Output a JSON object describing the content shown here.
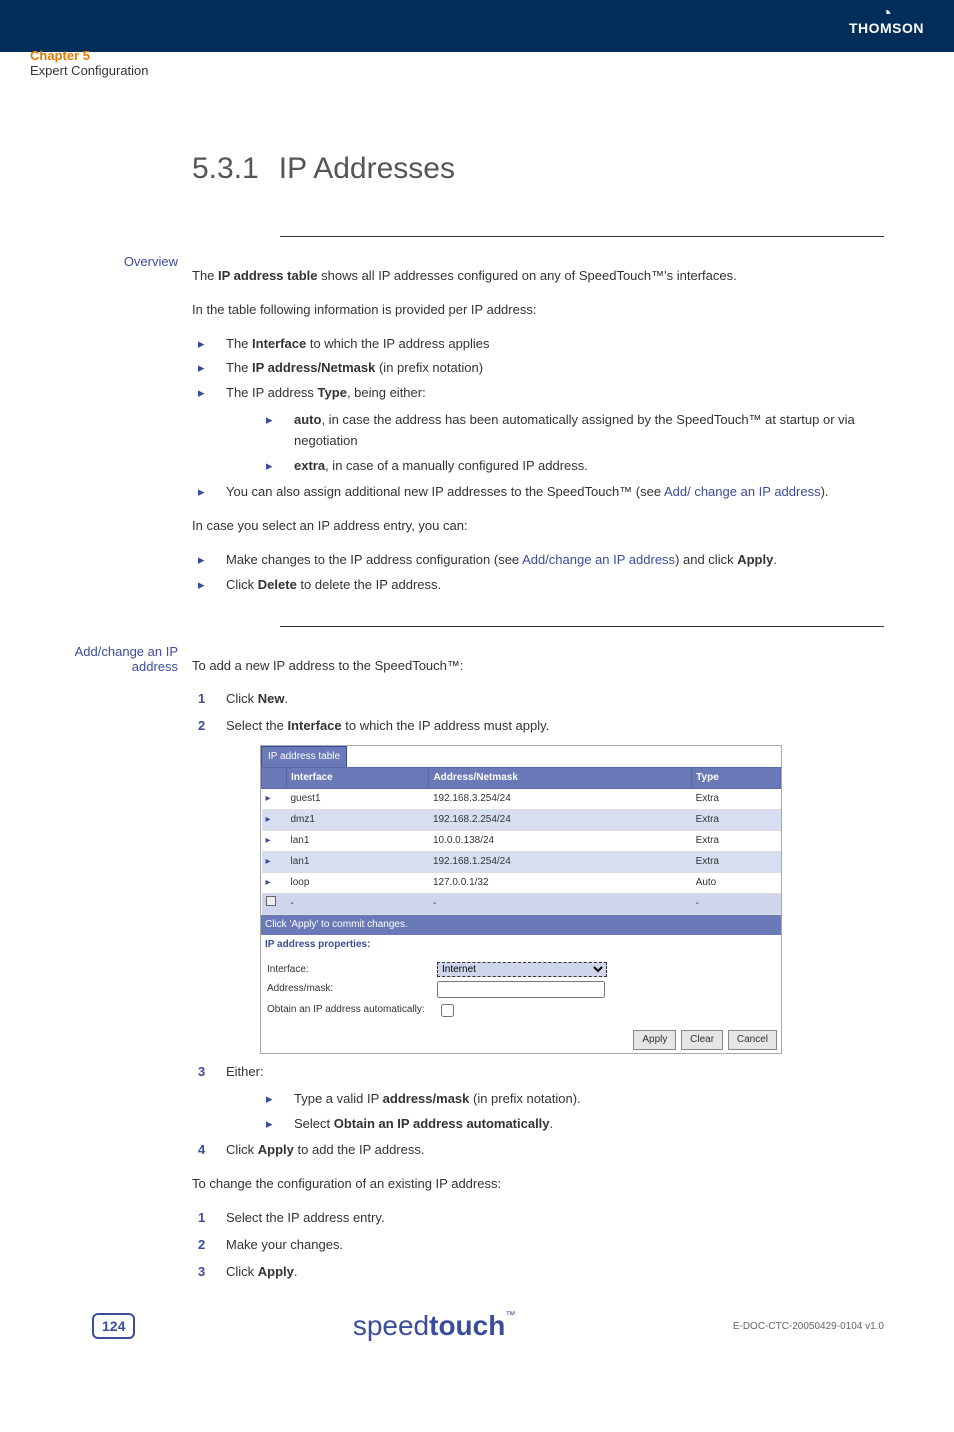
{
  "header": {
    "chapter": "Chapter 5",
    "subtitle": "Expert Configuration",
    "logo": "THOMSON"
  },
  "section": {
    "number": "5.3.1",
    "title": "IP Addresses"
  },
  "overview": {
    "label": "Overview",
    "p1_a": "The ",
    "p1_b": "IP address table",
    "p1_c": " shows all IP addresses configured on any of SpeedTouch™'s interfaces.",
    "p2": "In the table following information is provided per IP address:",
    "l1_a": "The ",
    "l1_b": "Interface",
    "l1_c": " to which the IP address applies",
    "l2_a": "The ",
    "l2_b": "IP address/Netmask",
    "l2_c": " (in prefix notation)",
    "l3_a": "The IP address ",
    "l3_b": "Type",
    "l3_c": ", being either:",
    "s1_a": "auto",
    "s1_b": ", in case the address has been automatically assigned by the SpeedTouch™ at startup or via negotiation",
    "s2_a": "extra",
    "s2_b": ", in case of a manually configured IP address.",
    "l4_a": "You can also assign additional new IP addresses to the SpeedTouch™ (see ",
    "l4_link": "Add/ change an IP address",
    "l4_c": ").",
    "p3": "In case you select an IP address entry, you can:",
    "l5_a": "Make changes to the IP address configuration (see ",
    "l5_link": "Add/change an IP address",
    "l5_b": ") and click ",
    "l5_c": "Apply",
    "l5_d": ".",
    "l6_a": "Click ",
    "l6_b": "Delete",
    "l6_c": " to delete the IP address."
  },
  "add": {
    "label": "Add/change an IP address",
    "p1": "To add a new IP address to the SpeedTouch™:",
    "n1_a": "Click ",
    "n1_b": "New",
    "n1_c": ".",
    "n2_a": "Select the ",
    "n2_b": "Interface",
    "n2_c": " to which the IP address must apply.",
    "n3": "Either:",
    "n3s1_a": "Type a valid IP ",
    "n3s1_b": "address/mask",
    "n3s1_c": " (in prefix notation).",
    "n3s2_a": "Select ",
    "n3s2_b": "Obtain an IP address automatically",
    "n3s2_c": ".",
    "n4_a": "Click ",
    "n4_b": "Apply",
    "n4_c": " to add the IP address.",
    "p2": "To change the configuration of an existing IP address:",
    "c1": "Select the IP address entry.",
    "c2": "Make your changes.",
    "c3_a": "Click ",
    "c3_b": "Apply",
    "c3_c": "."
  },
  "shot": {
    "tab": "IP address table",
    "cols": {
      "iface": "Interface",
      "addr": "Address/Netmask",
      "type": "Type"
    },
    "rows": [
      {
        "iface": "guest1",
        "addr": "192.168.3.254/24",
        "type": "Extra",
        "alt": false
      },
      {
        "iface": "dmz1",
        "addr": "192.168.2.254/24",
        "type": "Extra",
        "alt": true
      },
      {
        "iface": "lan1",
        "addr": "10.0.0.138/24",
        "type": "Extra",
        "alt": false
      },
      {
        "iface": "lan1",
        "addr": "192.168.1.254/24",
        "type": "Extra",
        "alt": true
      },
      {
        "iface": "loop",
        "addr": "127.0.0.1/32",
        "type": "Auto",
        "alt": false
      }
    ],
    "newrow": {
      "iface": "-",
      "addr": "-",
      "type": "-"
    },
    "msg": "Click 'Apply' to commit changes.",
    "props": "IP address properties:",
    "form": {
      "iface_lbl": "Interface:",
      "iface_val": "Internet",
      "addr_lbl": "Address/mask:",
      "addr_val": "",
      "auto_lbl": "Obtain an IP address automatically:"
    },
    "buttons": {
      "apply": "Apply",
      "clear": "Clear",
      "cancel": "Cancel"
    }
  },
  "footer": {
    "page": "124",
    "brand_a": "speed",
    "brand_b": "touch",
    "doc": "E-DOC-CTC-20050429-0104 v1.0"
  }
}
